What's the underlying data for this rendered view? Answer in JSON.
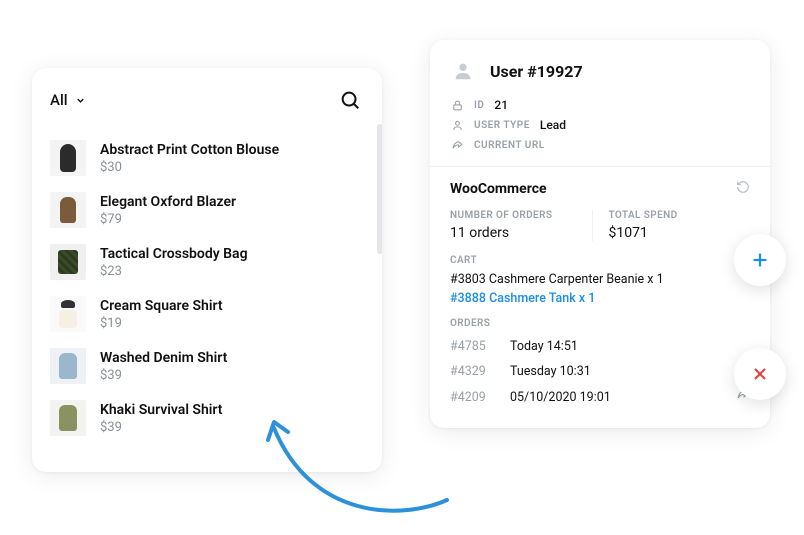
{
  "left": {
    "filter_label": "All",
    "products": [
      {
        "name": "Abstract Print Cotton Blouse",
        "price": "$30"
      },
      {
        "name": "Elegant Oxford Blazer",
        "price": "$79"
      },
      {
        "name": "Tactical Crossbody Bag",
        "price": "$23"
      },
      {
        "name": "Cream Square Shirt",
        "price": "$19"
      },
      {
        "name": "Washed Denim Shirt",
        "price": "$39"
      },
      {
        "name": "Khaki Survival Shirt",
        "price": "$39"
      }
    ]
  },
  "right": {
    "user_title": "User #19927",
    "meta": {
      "id_label": "ID",
      "id_value": "21",
      "user_type_label": "USER TYPE",
      "user_type_value": "Lead",
      "current_url_label": "CURRENT URL"
    },
    "section_title": "WooCommerce",
    "stats": {
      "orders_label": "NUMBER OF ORDERS",
      "orders_value": "11 orders",
      "spend_label": "TOTAL SPEND",
      "spend_value": "$1071"
    },
    "cart": {
      "label": "CART",
      "items": [
        {
          "text": "#3803 Cashmere Carpenter Beanie x 1",
          "link": false
        },
        {
          "text": "#3888 Cashmere Tank x 1",
          "link": true
        }
      ]
    },
    "orders": {
      "label": "ORDERS",
      "rows": [
        {
          "id": "#4785",
          "time": "Today 14:51",
          "share": false
        },
        {
          "id": "#4329",
          "time": "Tuesday 10:31",
          "share": true
        },
        {
          "id": "#4209",
          "time": "05/10/2020 19:01",
          "share": true
        }
      ]
    }
  },
  "colors": {
    "accent": "#1a8de6",
    "danger": "#e63a3a",
    "muted": "#9aa0a9"
  }
}
